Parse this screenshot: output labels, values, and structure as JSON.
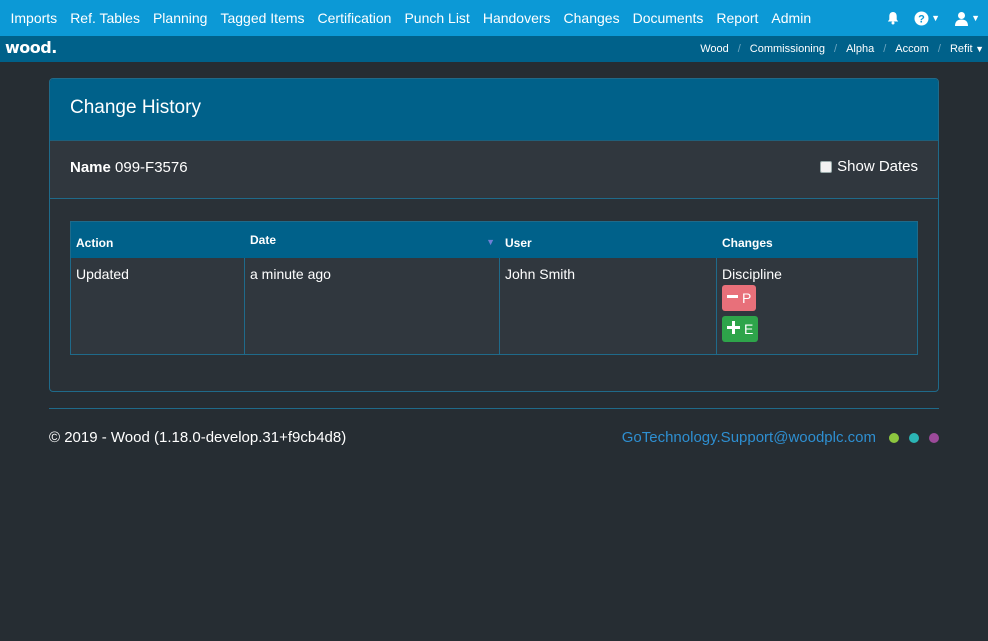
{
  "nav": {
    "items": [
      "Imports",
      "Ref. Tables",
      "Planning",
      "Tagged Items",
      "Certification",
      "Punch List",
      "Handovers",
      "Changes",
      "Documents",
      "Report",
      "Admin"
    ],
    "right_icons": [
      "bell-icon",
      "help-icon",
      "user-icon"
    ]
  },
  "brand": {
    "logo": "wood."
  },
  "breadcrumb": [
    "Wood",
    "Commissioning",
    "Alpha",
    "Accom",
    "Refit"
  ],
  "panel": {
    "title": "Change History",
    "name_label": "Name",
    "name_value": "099-F3576",
    "show_dates_label": "Show Dates",
    "show_dates_checked": false
  },
  "table": {
    "headers": [
      "Action",
      "Date",
      "User",
      "Changes"
    ],
    "sort": {
      "column": "Date",
      "direction": "desc"
    },
    "rows": [
      {
        "action": "Updated",
        "date": "a minute ago",
        "user": "John Smith",
        "field": "Discipline",
        "removed": "P",
        "added": "E"
      }
    ]
  },
  "footer": {
    "copyright": "© 2019 - Wood (1.18.0-develop.31+f9cb4d8)",
    "support_email": "GoTechnology.Support@woodplc.com",
    "dot_colors": [
      "#8dc63f",
      "#2bb5b5",
      "#9c4a9a"
    ]
  },
  "colors": {
    "topnav": "#0c99d6",
    "subbar": "#00618a",
    "background": "#262d33",
    "remove_tag": "#e8707a",
    "add_tag": "#2ea44a"
  }
}
